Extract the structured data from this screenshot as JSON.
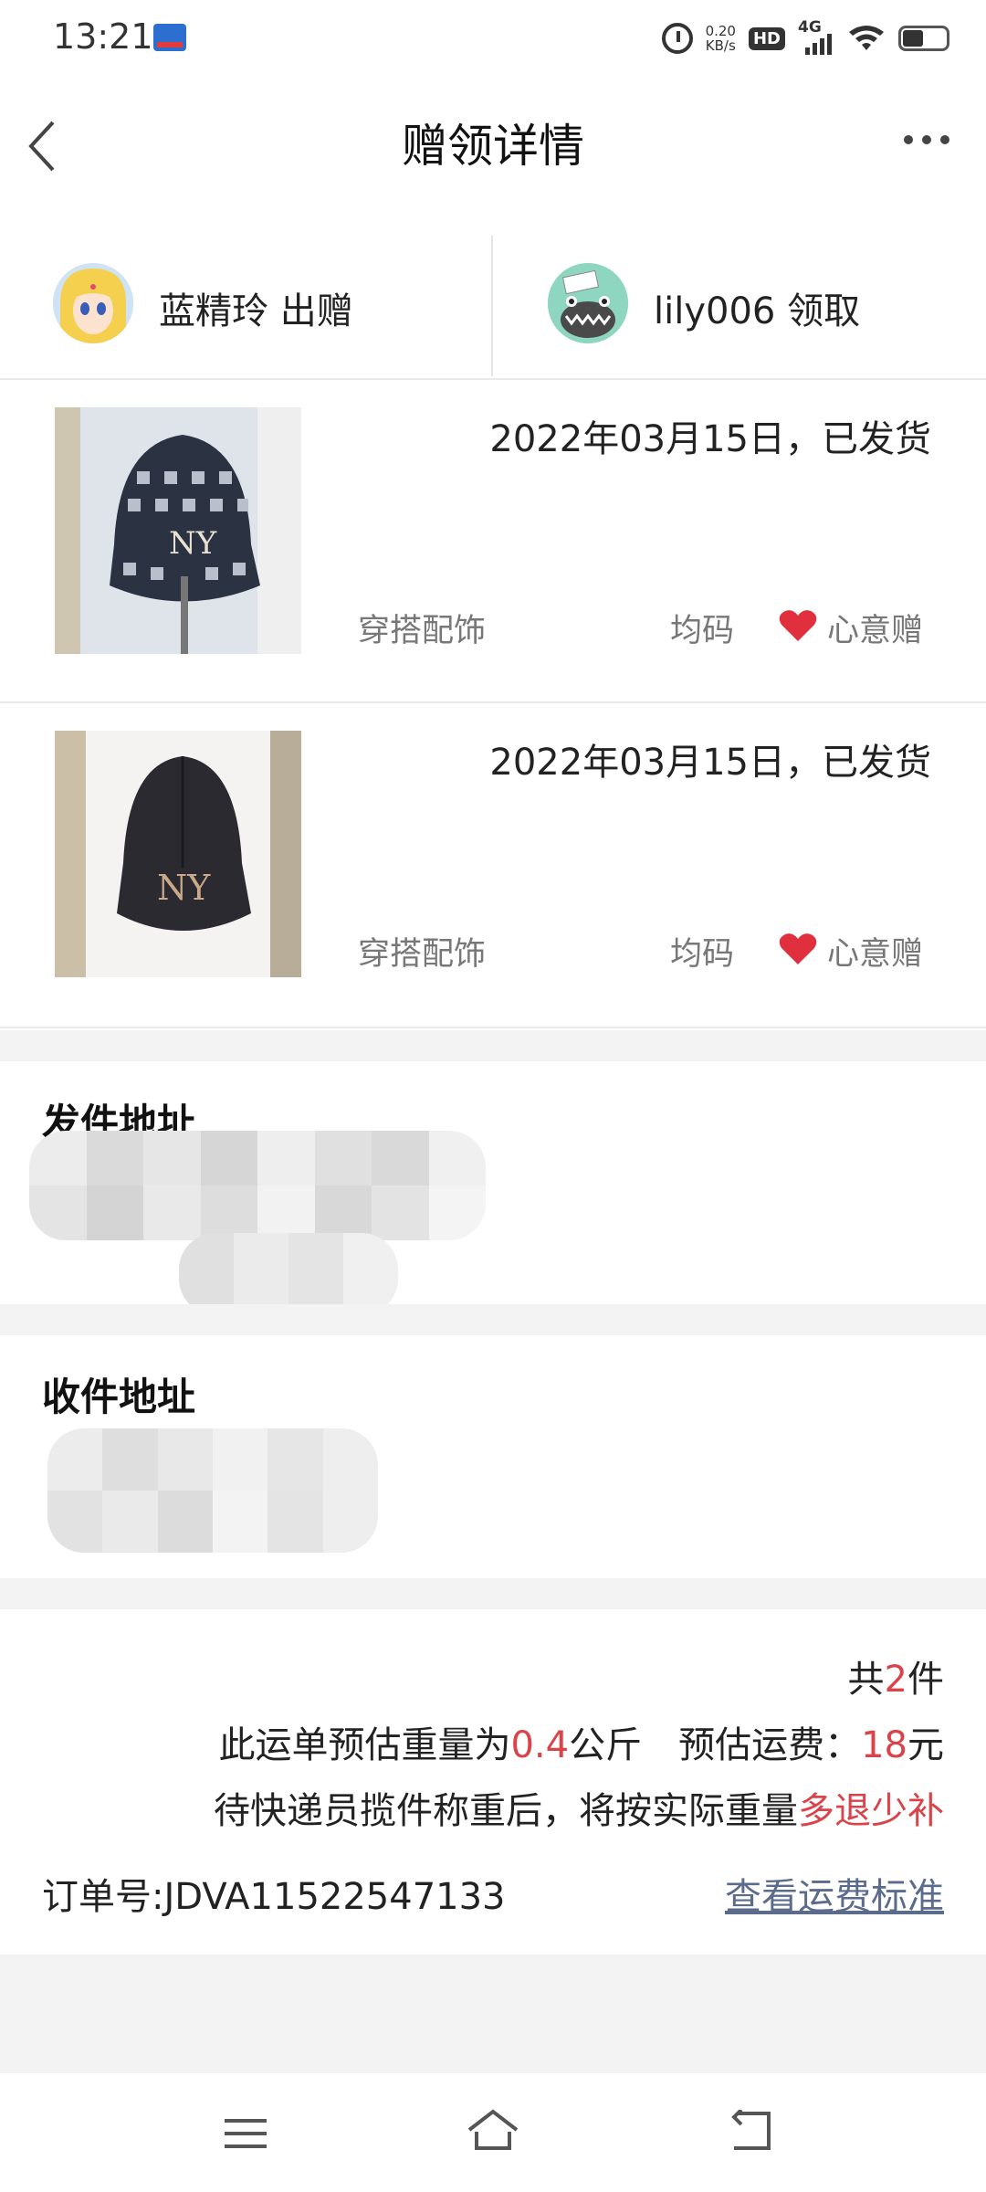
{
  "status_bar": {
    "time": "13:21",
    "network_speed": "0.20",
    "network_speed_unit": "KB/s",
    "hd_badge": "HD",
    "network_type": "4G"
  },
  "header": {
    "title": "赠领详情"
  },
  "users": {
    "giver": {
      "name": "蓝精玲",
      "action": "出赠",
      "label": "蓝精玲 出赠"
    },
    "receiver": {
      "name": "lily006",
      "action": "领取",
      "label": "lily006 领取"
    }
  },
  "items": [
    {
      "date_status": "2022年03月15日，已发货",
      "category": "穿搭配饰",
      "size": "均码",
      "tag": "心意赠"
    },
    {
      "date_status": "2022年03月15日，已发货",
      "category": "穿搭配饰",
      "size": "均码",
      "tag": "心意赠"
    }
  ],
  "addresses": {
    "sender_title": "发件地址",
    "receiver_title": "收件地址"
  },
  "summary": {
    "count_prefix": "共",
    "count": "2",
    "count_suffix": "件",
    "weight_prefix": "此运单预估重量为",
    "weight": "0.4",
    "weight_unit": "公斤",
    "fee_label": "预估运费：",
    "fee": "18",
    "fee_unit": "元",
    "note_prefix": "待快递员揽件称重后，将按实际重量",
    "note_accent": "多退少补",
    "order_label": "订单号:",
    "order_no": "JDVA11522547133",
    "fee_standard_link": "查看运费标准"
  },
  "colors": {
    "accent": "#d9434a",
    "link": "#5a6b8c",
    "heart": "#e0303d",
    "divider": "#eaeaea",
    "gap": "#f3f3f3"
  }
}
